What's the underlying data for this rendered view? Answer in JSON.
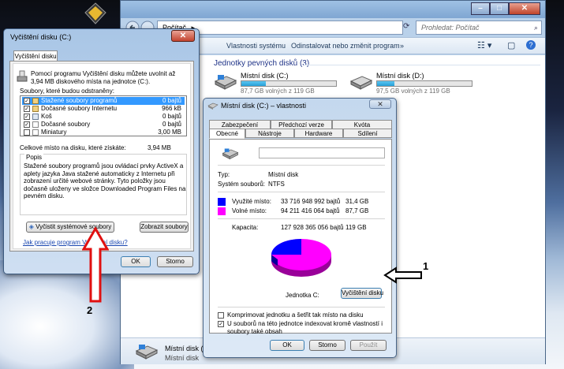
{
  "explorer": {
    "address": "Počítač",
    "search_placeholder": "Prohledat: Počítač",
    "toolbar": {
      "item_system_properties": "Vlastnosti systému",
      "item_uninstall": "Odinstalovat nebo změnit program",
      "item_more": "»"
    },
    "group_title": "Jednotky pevných disků (3)",
    "drives": [
      {
        "name": "Místní disk (C:)",
        "free": "87,7 GB volných z 119 GB",
        "used_fraction": 0.26
      },
      {
        "name": "Místní disk (D:)",
        "free": "97,5 GB volných z 119 GB",
        "used_fraction": 0.18
      }
    ],
    "status": {
      "name": "Místní disk (C:",
      "sub": "Místní disk"
    },
    "colors": {
      "chrome": "#b9d1ea",
      "link": "#1e3287"
    }
  },
  "cleanup": {
    "title": "Vyčištění disku  (C:)",
    "tab": "Vyčištění disku",
    "intro": "Pomocí programu Vyčištění disku můžete uvolnit až 3,94 MB diskového místa na jednotce  (C:).",
    "files_label": "Soubory, které budou odstraněny:",
    "items": [
      {
        "name": "Stažené soubory programů",
        "value": "0 bajtů",
        "checked": true,
        "selected": true
      },
      {
        "name": "Dočasné soubory Internetu",
        "value": "966 kB",
        "checked": true,
        "selected": false
      },
      {
        "name": "Koš",
        "value": "0 bajtů",
        "checked": true,
        "selected": false
      },
      {
        "name": "Dočasné soubory",
        "value": "0 bajtů",
        "checked": true,
        "selected": false
      },
      {
        "name": "Miniatury",
        "value": "3,00 MB",
        "checked": false,
        "selected": false
      }
    ],
    "total_label": "Celkové místo na disku, které získáte:",
    "total_value": "3,94 MB",
    "description_title": "Popis",
    "description": "Stažené soubory programů jsou ovládací prvky ActiveX a aplety jazyka Java stažené automaticky z Internetu při zobrazení určité webové stránky. Tyto položky jsou dočasně uloženy ve složce Downloaded Program Files na pevném disku.",
    "btn_clean_system": "Vyčistit systémové soubory",
    "btn_view_files": "Zobrazit soubory",
    "link_how": "Jak pracuje program Vyčištění disku?",
    "btn_ok": "OK",
    "btn_cancel": "Storno"
  },
  "properties": {
    "title": "Místní disk (C:) – vlastnosti",
    "tabs_top": [
      "Zabezpečení",
      "Předchozí verze",
      "Kvóta"
    ],
    "tabs_bottom": [
      "Obecné",
      "Nástroje",
      "Hardware",
      "Sdílení"
    ],
    "type_label": "Typ:",
    "type_value": "Místní disk",
    "fs_label": "Systém souborů:",
    "fs_value": "NTFS",
    "used": {
      "label": "Využité místo:",
      "bytes": "33 716 948 992 bajtů",
      "gb": "31,4 GB",
      "color": "#0000ff"
    },
    "free": {
      "label": "Volné místo:",
      "bytes": "94 211 416 064 bajtů",
      "gb": "87,7 GB",
      "color": "#ff00ff"
    },
    "capacity": {
      "label": "Kapacita:",
      "bytes": "127 928 365 056 bajtů",
      "gb": "119 GB"
    },
    "drive_label": "Jednotka C:",
    "btn_cleanup": "Vyčištění disku",
    "check_compress": "Komprimovat jednotku a šetřit tak místo na disku",
    "check_index": "U souborů na této jednotce indexovat kromě vlastností i soubory také obsah",
    "btn_ok": "OK",
    "btn_cancel": "Storno",
    "btn_apply": "Použít"
  },
  "annotations": {
    "arrow1": "1",
    "arrow2": "2",
    "arrow_red": "#e01010"
  }
}
